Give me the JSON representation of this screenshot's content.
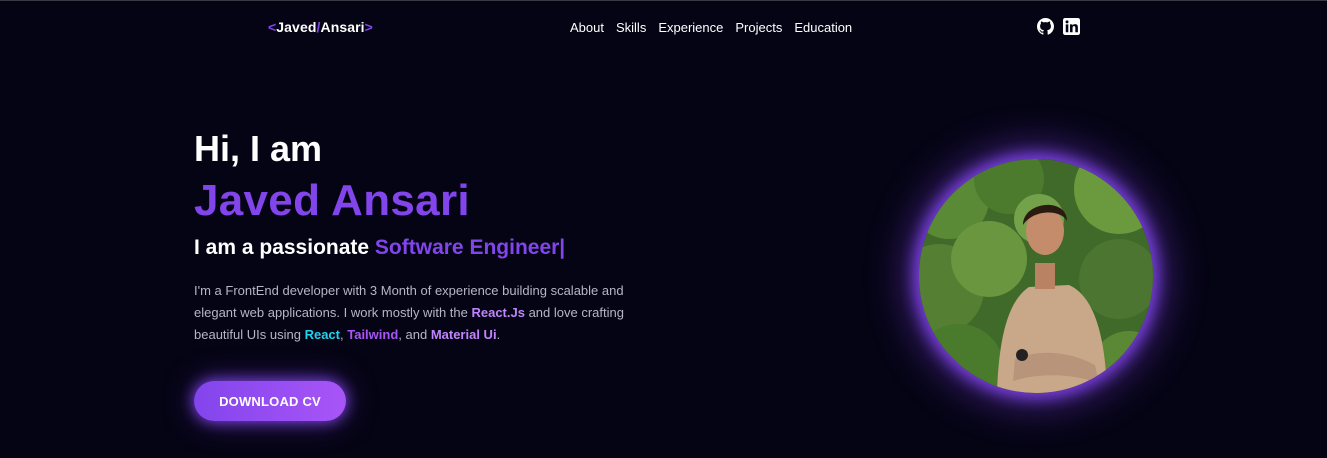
{
  "nav": {
    "logo": {
      "open": "<",
      "first": "Javed",
      "slash": "/",
      "last": "Ansari",
      "close": ">"
    },
    "links": [
      "About",
      "Skills",
      "Experience",
      "Projects",
      "Education"
    ],
    "socials": [
      {
        "icon": "github-icon"
      },
      {
        "icon": "linkedin-icon"
      }
    ]
  },
  "hero": {
    "greeting": "Hi, I am",
    "name": "Javed Ansari",
    "tagline_prefix": "I am a passionate ",
    "tagline_role": "Software Engineer|",
    "desc": {
      "part1": "I'm a FrontEnd developer with 3 Month of experience building scalable and elegant web applications. I work mostly with the ",
      "hl1": "React.Js",
      "part2": " and love crafting beautiful UIs using ",
      "hl2": "React",
      "sep1": ", ",
      "hl3": "Tailwind",
      "sep2": ", and ",
      "hl4": "Material Ui",
      "end": "."
    },
    "cta_label": "DOWNLOAD CV"
  },
  "colors": {
    "background": "#050414",
    "accent": "#8245ec",
    "text": "#ffffff",
    "muted": "#b5b6c4",
    "highlight_cyan": "#22d3ee"
  }
}
